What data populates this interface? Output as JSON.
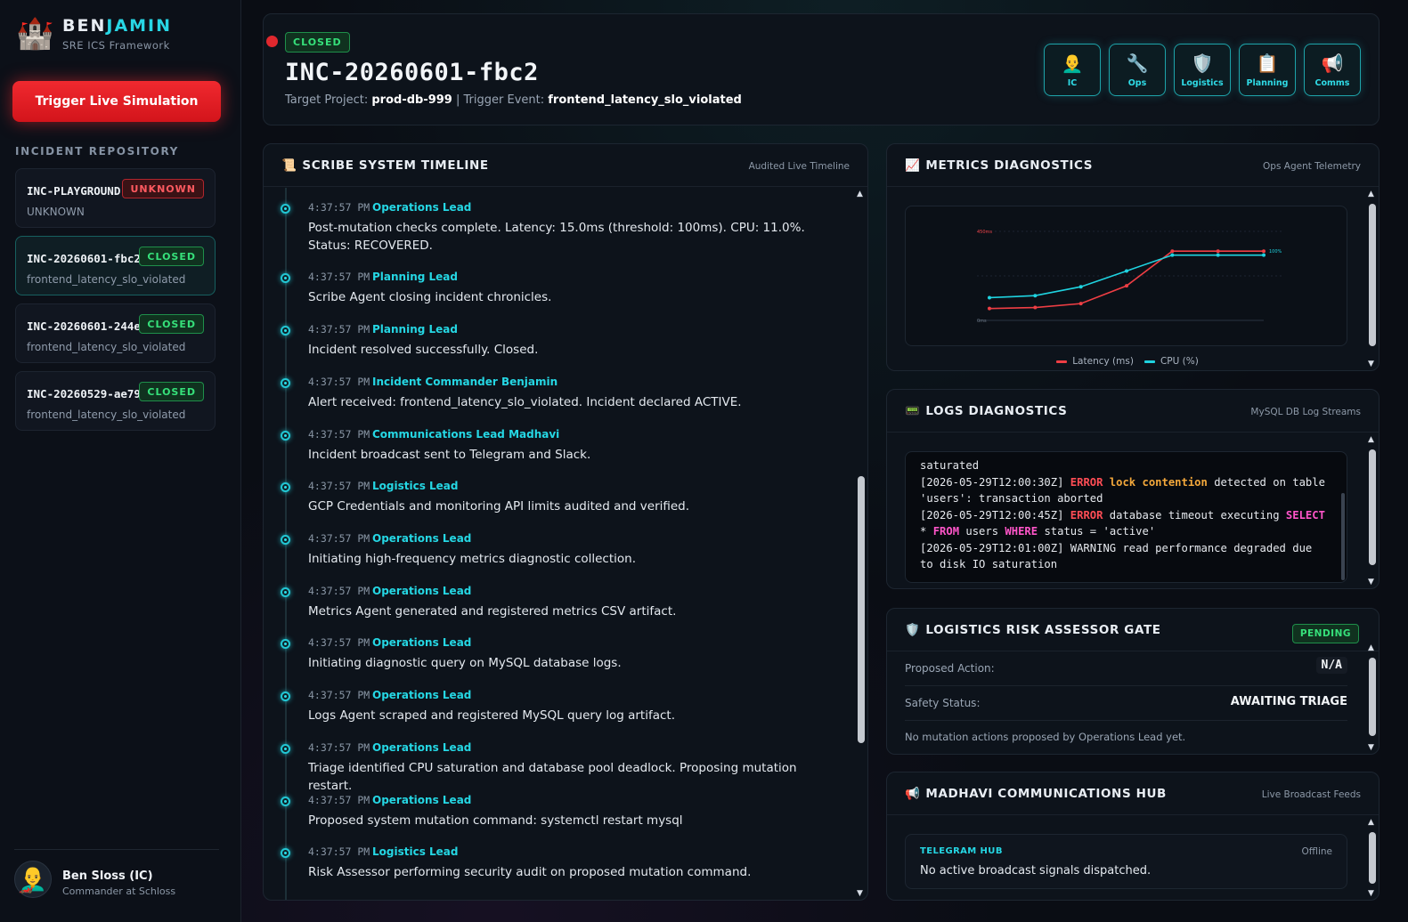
{
  "brand": {
    "name_a": "BEN",
    "name_b": "JAMIN",
    "subtitle": "SRE ICS Framework",
    "logo_icon": "castle-icon"
  },
  "sidebar": {
    "trigger_label": "Trigger Live Simulation",
    "repo_title": "INCIDENT REPOSITORY",
    "incidents": [
      {
        "id": "INC-PLAYGROUND",
        "status": "UNKNOWN",
        "subtitle": "UNKNOWN"
      },
      {
        "id": "INC-20260601-fbc2",
        "status": "CLOSED",
        "subtitle": "frontend_latency_slo_violated"
      },
      {
        "id": "INC-20260601-244e",
        "status": "CLOSED",
        "subtitle": "frontend_latency_slo_violated"
      },
      {
        "id": "INC-20260529-ae79",
        "status": "CLOSED",
        "subtitle": "frontend_latency_slo_violated"
      }
    ],
    "user": {
      "name": "Ben Sloss (IC)",
      "role": "Commander at Schloss"
    }
  },
  "header": {
    "status": "CLOSED",
    "title": "INC-20260601-fbc2",
    "target_label": "Target Project:",
    "target_value": "prod-db-999",
    "separator": "|",
    "trigger_label": "Trigger Event:",
    "trigger_value": "frontend_latency_slo_violated",
    "roles": [
      {
        "label": "IC",
        "icon": "👨‍🦲"
      },
      {
        "label": "Ops",
        "icon": "🔧"
      },
      {
        "label": "Logistics",
        "icon": "🛡️"
      },
      {
        "label": "Planning",
        "icon": "📋"
      },
      {
        "label": "Comms",
        "icon": "📢"
      }
    ]
  },
  "timeline": {
    "title": "SCRIBE SYSTEM TIMELINE",
    "icon": "📜",
    "note": "Audited Live Timeline",
    "entries": [
      {
        "time": "4:37:57 PM",
        "actor": "Operations Lead",
        "msg": "Post-mutation checks complete. Latency: 15.0ms (threshold: 100ms). CPU: 11.0%. Status: RECOVERED."
      },
      {
        "time": "4:37:57 PM",
        "actor": "Planning Lead",
        "msg": "Scribe Agent closing incident chronicles."
      },
      {
        "time": "4:37:57 PM",
        "actor": "Planning Lead",
        "msg": "Incident resolved successfully. Closed."
      },
      {
        "time": "4:37:57 PM",
        "actor": "Incident Commander Benjamin",
        "msg": "Alert received: frontend_latency_slo_violated. Incident declared ACTIVE."
      },
      {
        "time": "4:37:57 PM",
        "actor": "Communications Lead Madhavi",
        "msg": "Incident broadcast sent to Telegram and Slack."
      },
      {
        "time": "4:37:57 PM",
        "actor": "Logistics Lead",
        "msg": "GCP Credentials and monitoring API limits audited and verified."
      },
      {
        "time": "4:37:57 PM",
        "actor": "Operations Lead",
        "msg": "Initiating high-frequency metrics diagnostic collection."
      },
      {
        "time": "4:37:57 PM",
        "actor": "Operations Lead",
        "msg": "Metrics Agent generated and registered metrics CSV artifact."
      },
      {
        "time": "4:37:57 PM",
        "actor": "Operations Lead",
        "msg": "Initiating diagnostic query on MySQL database logs."
      },
      {
        "time": "4:37:57 PM",
        "actor": "Operations Lead",
        "msg": "Logs Agent scraped and registered MySQL query log artifact."
      },
      {
        "time": "4:37:57 PM",
        "actor": "Operations Lead",
        "msg": "Triage identified CPU saturation and database pool deadlock. Proposing mutation restart."
      },
      {
        "time": "4:37:57 PM",
        "actor": "Operations Lead",
        "msg": "Proposed system mutation command: systemctl restart mysql"
      },
      {
        "time": "4:37:57 PM",
        "actor": "Logistics Lead",
        "msg": "Risk Assessor performing security audit on proposed mutation command."
      }
    ]
  },
  "metrics": {
    "title": "METRICS DIAGNOSTICS",
    "icon": "📈",
    "note": "Ops Agent Telemetry"
  },
  "chart_data": {
    "type": "line",
    "x": [
      1,
      2,
      3,
      4,
      5,
      6,
      7
    ],
    "ylim": [
      0,
      450
    ],
    "ytick_labels": [
      "0ms",
      "450ms"
    ],
    "right_label": "100%",
    "series": [
      {
        "name": "Latency (ms)",
        "color": "#ef3e44",
        "values": [
          60,
          65,
          85,
          175,
          350,
          350,
          350
        ]
      },
      {
        "name": "CPU (%)",
        "color": "#1fd3e0",
        "values": [
          115,
          125,
          170,
          250,
          330,
          330,
          330
        ]
      }
    ],
    "legend_position": "bottom"
  },
  "logs": {
    "title": "LOGS DIAGNOSTICS",
    "icon": "📟",
    "note": "MySQL DB Log Streams",
    "lines": [
      {
        "parts": [
          {
            "t": "saturated",
            "c": ""
          }
        ]
      },
      {
        "parts": [
          {
            "t": "[2026-05-29T12:00:30Z] ",
            "c": ""
          },
          {
            "t": "ERROR",
            "c": "err"
          },
          {
            "t": " ",
            "c": ""
          },
          {
            "t": "lock contention",
            "c": "kw"
          },
          {
            "t": " detected on table 'users': transaction aborted",
            "c": ""
          }
        ]
      },
      {
        "parts": [
          {
            "t": "[2026-05-29T12:00:45Z] ",
            "c": ""
          },
          {
            "t": "ERROR",
            "c": "err"
          },
          {
            "t": " database timeout executing ",
            "c": ""
          },
          {
            "t": "SELECT",
            "c": "sq"
          },
          {
            "t": " * ",
            "c": ""
          },
          {
            "t": "FROM",
            "c": "sq"
          },
          {
            "t": " users ",
            "c": ""
          },
          {
            "t": "WHERE",
            "c": "sq"
          },
          {
            "t": " status = 'active'",
            "c": ""
          }
        ]
      },
      {
        "parts": [
          {
            "t": "[2026-05-29T12:01:00Z] WARNING read performance degraded due to disk IO saturation",
            "c": ""
          }
        ]
      }
    ]
  },
  "risk": {
    "title": "LOGISTICS RISK ASSESSOR GATE",
    "icon": "🛡️",
    "status": "PENDING",
    "proposed_label": "Proposed Action:",
    "proposed_value": "N/A",
    "safety_label": "Safety Status:",
    "safety_value": "AWAITING TRIAGE",
    "note": "No mutation actions proposed by Operations Lead yet."
  },
  "comms": {
    "title": "MADHAVI COMMUNICATIONS HUB",
    "icon": "📢",
    "note": "Live Broadcast Feeds",
    "hub_title": "TELEGRAM HUB",
    "hub_state": "Offline",
    "hub_msg": "No active broadcast signals dispatched."
  }
}
